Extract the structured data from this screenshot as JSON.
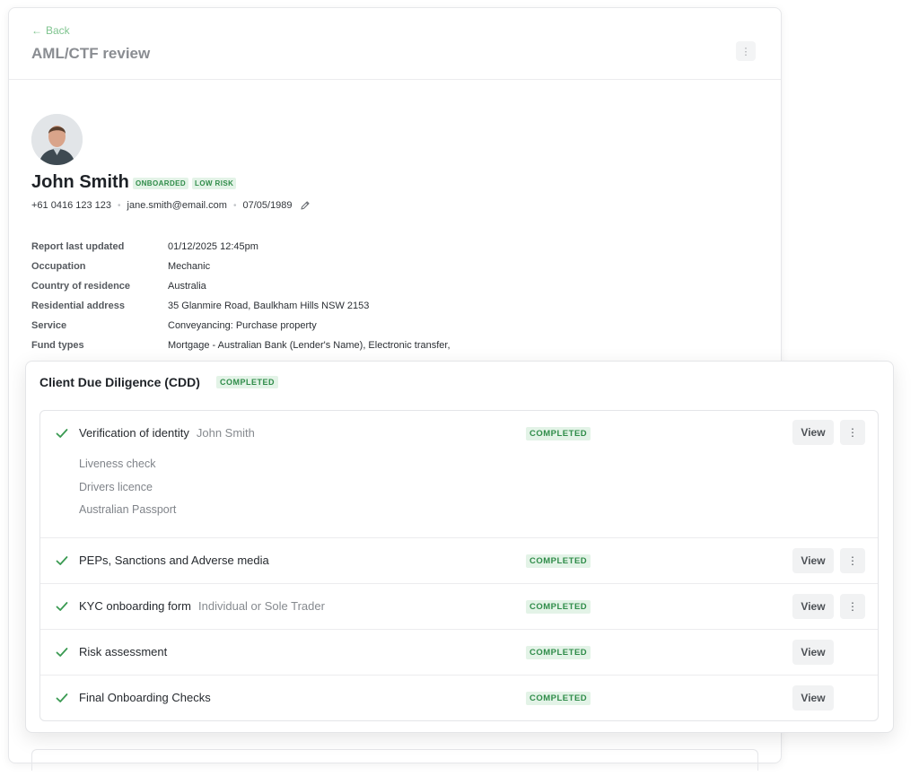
{
  "header": {
    "back_label": "Back",
    "title": "AML/CTF review"
  },
  "profile": {
    "name": "John Smith",
    "badges": [
      "ONBOARDED",
      "LOW RISK"
    ],
    "phone": "+61 0416 123 123",
    "email": "jane.smith@email.com",
    "dob": "07/05/1989"
  },
  "details": [
    {
      "label": "Report last updated",
      "value": "01/12/2025  12:45pm"
    },
    {
      "label": "Occupation",
      "value": "Mechanic"
    },
    {
      "label": "Country of residence",
      "value": "Australia"
    },
    {
      "label": "Residential address",
      "value": "35 Glanmire Road, Baulkham Hills NSW 2153"
    },
    {
      "label": "Service",
      "value": "Conveyancing: Purchase property"
    },
    {
      "label": "Fund types",
      "value": "Mortgage - Australian Bank (Lender's Name),  Electronic transfer,"
    }
  ],
  "cdd": {
    "title": "Client Due Diligence (CDD)",
    "status": "COMPLETED",
    "checks": [
      {
        "title": "Verification of identity",
        "subtitle": "John Smith",
        "status": "COMPLETED",
        "view_label": "View",
        "sub_items": [
          "Liveness check",
          "Drivers licence",
          "Australian Passport"
        ]
      },
      {
        "title": "PEPs, Sanctions and Adverse media",
        "subtitle": "",
        "status": "COMPLETED",
        "view_label": "View"
      },
      {
        "title": "KYC onboarding form",
        "subtitle": "Individual or Sole Trader",
        "status": "COMPLETED",
        "view_label": "View"
      },
      {
        "title": "Risk assessment",
        "subtitle": "",
        "status": "COMPLETED",
        "view_label": "View"
      },
      {
        "title": "Final Onboarding Checks",
        "subtitle": "",
        "status": "COMPLETED",
        "view_label": "View"
      }
    ]
  },
  "colors": {
    "accent_green": "#2f8c49",
    "badge_bg": "#e3f3e7",
    "back_link": "#7fc48f"
  },
  "icons": {
    "back": "arrow-left-icon",
    "more": "kebab-vertical-icon",
    "edit": "pencil-icon",
    "check": "check-icon"
  }
}
